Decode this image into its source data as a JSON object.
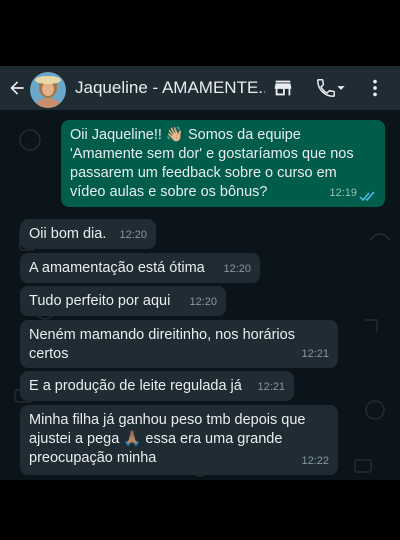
{
  "header": {
    "contact_name": "Jaqueline - AMAMENTE...",
    "icons": [
      "back-arrow-icon",
      "avatar",
      "store-icon",
      "call-icon",
      "more-vertical-icon"
    ]
  },
  "colors": {
    "header_bg": "#1f2c34",
    "chat_bg": "#0b141a",
    "incoming_bubble": "#202c33",
    "outgoing_bubble": "#005c4b",
    "read_ticks": "#53bdeb"
  },
  "messages": [
    {
      "direction": "outgoing",
      "text": "Oii Jaqueline!! 👋🏼 Somos da equipe\n'Amamente sem dor' e gostaríamos que nos\npassarem um feedback sobre o curso em\nvídeo aulas e sobre os bônus?",
      "time": "12:19",
      "status": "read"
    },
    {
      "direction": "incoming",
      "text": "Oii bom dia.",
      "time": "12:20"
    },
    {
      "direction": "incoming",
      "text": "A amamentação está ótima",
      "time": "12:20"
    },
    {
      "direction": "incoming",
      "text": "Tudo perfeito por aqui",
      "time": "12:20"
    },
    {
      "direction": "incoming",
      "text": "Neném mamando direitinho, nos horários\ncertos",
      "time": "12:21"
    },
    {
      "direction": "incoming",
      "text": "E a produção de leite regulada já",
      "time": "12:21"
    },
    {
      "direction": "incoming",
      "text": "Minha filha já ganhou peso tmb depois que\najustei a pega 🙏🏽 essa era uma grande\npreocupação minha",
      "time": "12:22"
    }
  ]
}
